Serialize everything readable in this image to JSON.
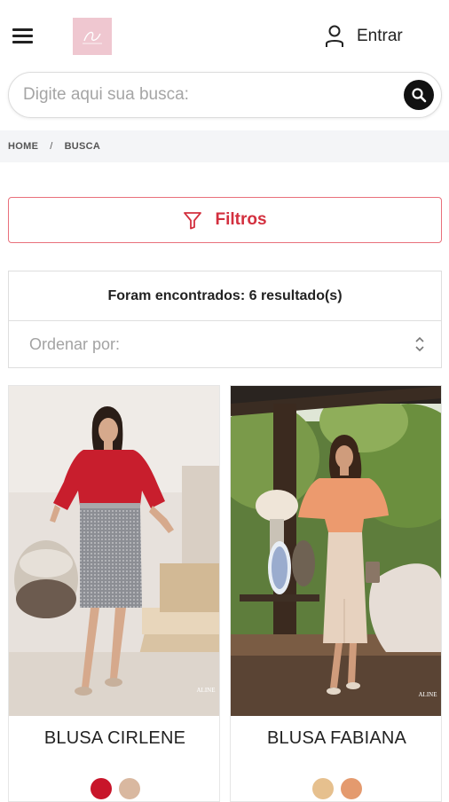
{
  "header": {
    "login_label": "Entrar"
  },
  "search": {
    "placeholder": "Digite aqui sua busca:"
  },
  "breadcrumb": {
    "items": [
      "HOME",
      "BUSCA"
    ],
    "separator": "/"
  },
  "filters": {
    "label": "Filtros"
  },
  "results": {
    "count_text": "Foram encontrados: 6 resultado(s)",
    "sort_placeholder": "Ordenar por:"
  },
  "products": [
    {
      "name": "BLUSA CIRLENE",
      "colors": [
        "#c8152a",
        "#d9b8a0"
      ]
    },
    {
      "name": "BLUSA FABIANA",
      "colors": [
        "#e6c08e",
        "#e49a6e"
      ]
    }
  ],
  "colors": {
    "accent": "#d3303f",
    "logo_bg": "#efc7d0",
    "breadcrumb_bg": "#f4f5f7"
  },
  "icons": [
    "menu-icon",
    "user-icon",
    "search-icon",
    "filter-icon",
    "sort-chevrons-icon"
  ]
}
